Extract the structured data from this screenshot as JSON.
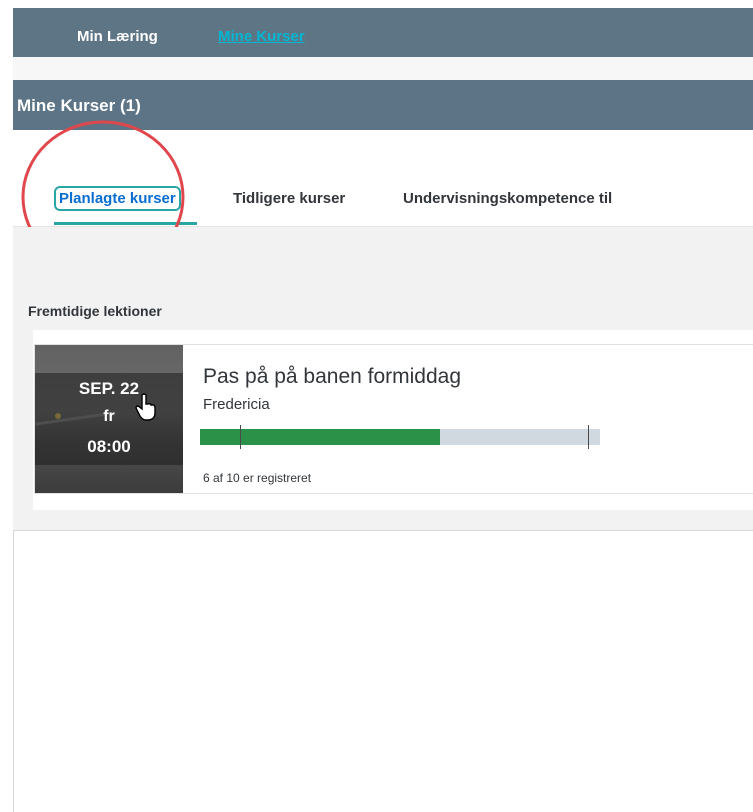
{
  "topnav": {
    "items": [
      "Min Læring",
      "Mine Kurser"
    ]
  },
  "section": {
    "title": "Mine Kurser (1)"
  },
  "tabs": [
    "Planlagte kurser",
    "Tidligere kurser",
    "Undervisningskompetence til"
  ],
  "upcoming": {
    "heading": "Fremtidige lektioner",
    "course": {
      "date": "SEP. 22",
      "day": "fr",
      "time": "08:00",
      "title": "Pas på på banen formiddag",
      "location": "Fredericia",
      "registered_text": "6 af 10 er registreret",
      "registered": 6,
      "capacity": 10
    }
  },
  "colors": {
    "nav_bg": "#5e7585",
    "active_link": "#00b7d4",
    "tab_accent": "#2aa5a5",
    "progress_fill": "#2b9048",
    "progress_track": "#d1d9e0",
    "annotation_circle": "#e0474c"
  }
}
